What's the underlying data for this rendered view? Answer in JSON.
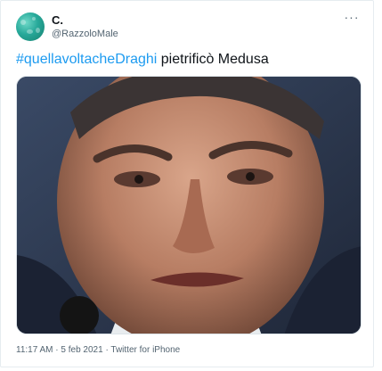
{
  "tweet": {
    "author_name": "C.",
    "author_handle": "@RazzoloMale",
    "more_icon": "more-horizontal-icon",
    "hashtag": "#quellavoltacheDraghi",
    "text": " pietrificò Medusa",
    "timestamp": "11:17 AM · 5 feb 2021",
    "separator": " · ",
    "source": "Twitter for iPhone"
  },
  "colors": {
    "link": "#1d9bf0",
    "secondary_text": "#536471",
    "border": "#e6ecf0"
  }
}
